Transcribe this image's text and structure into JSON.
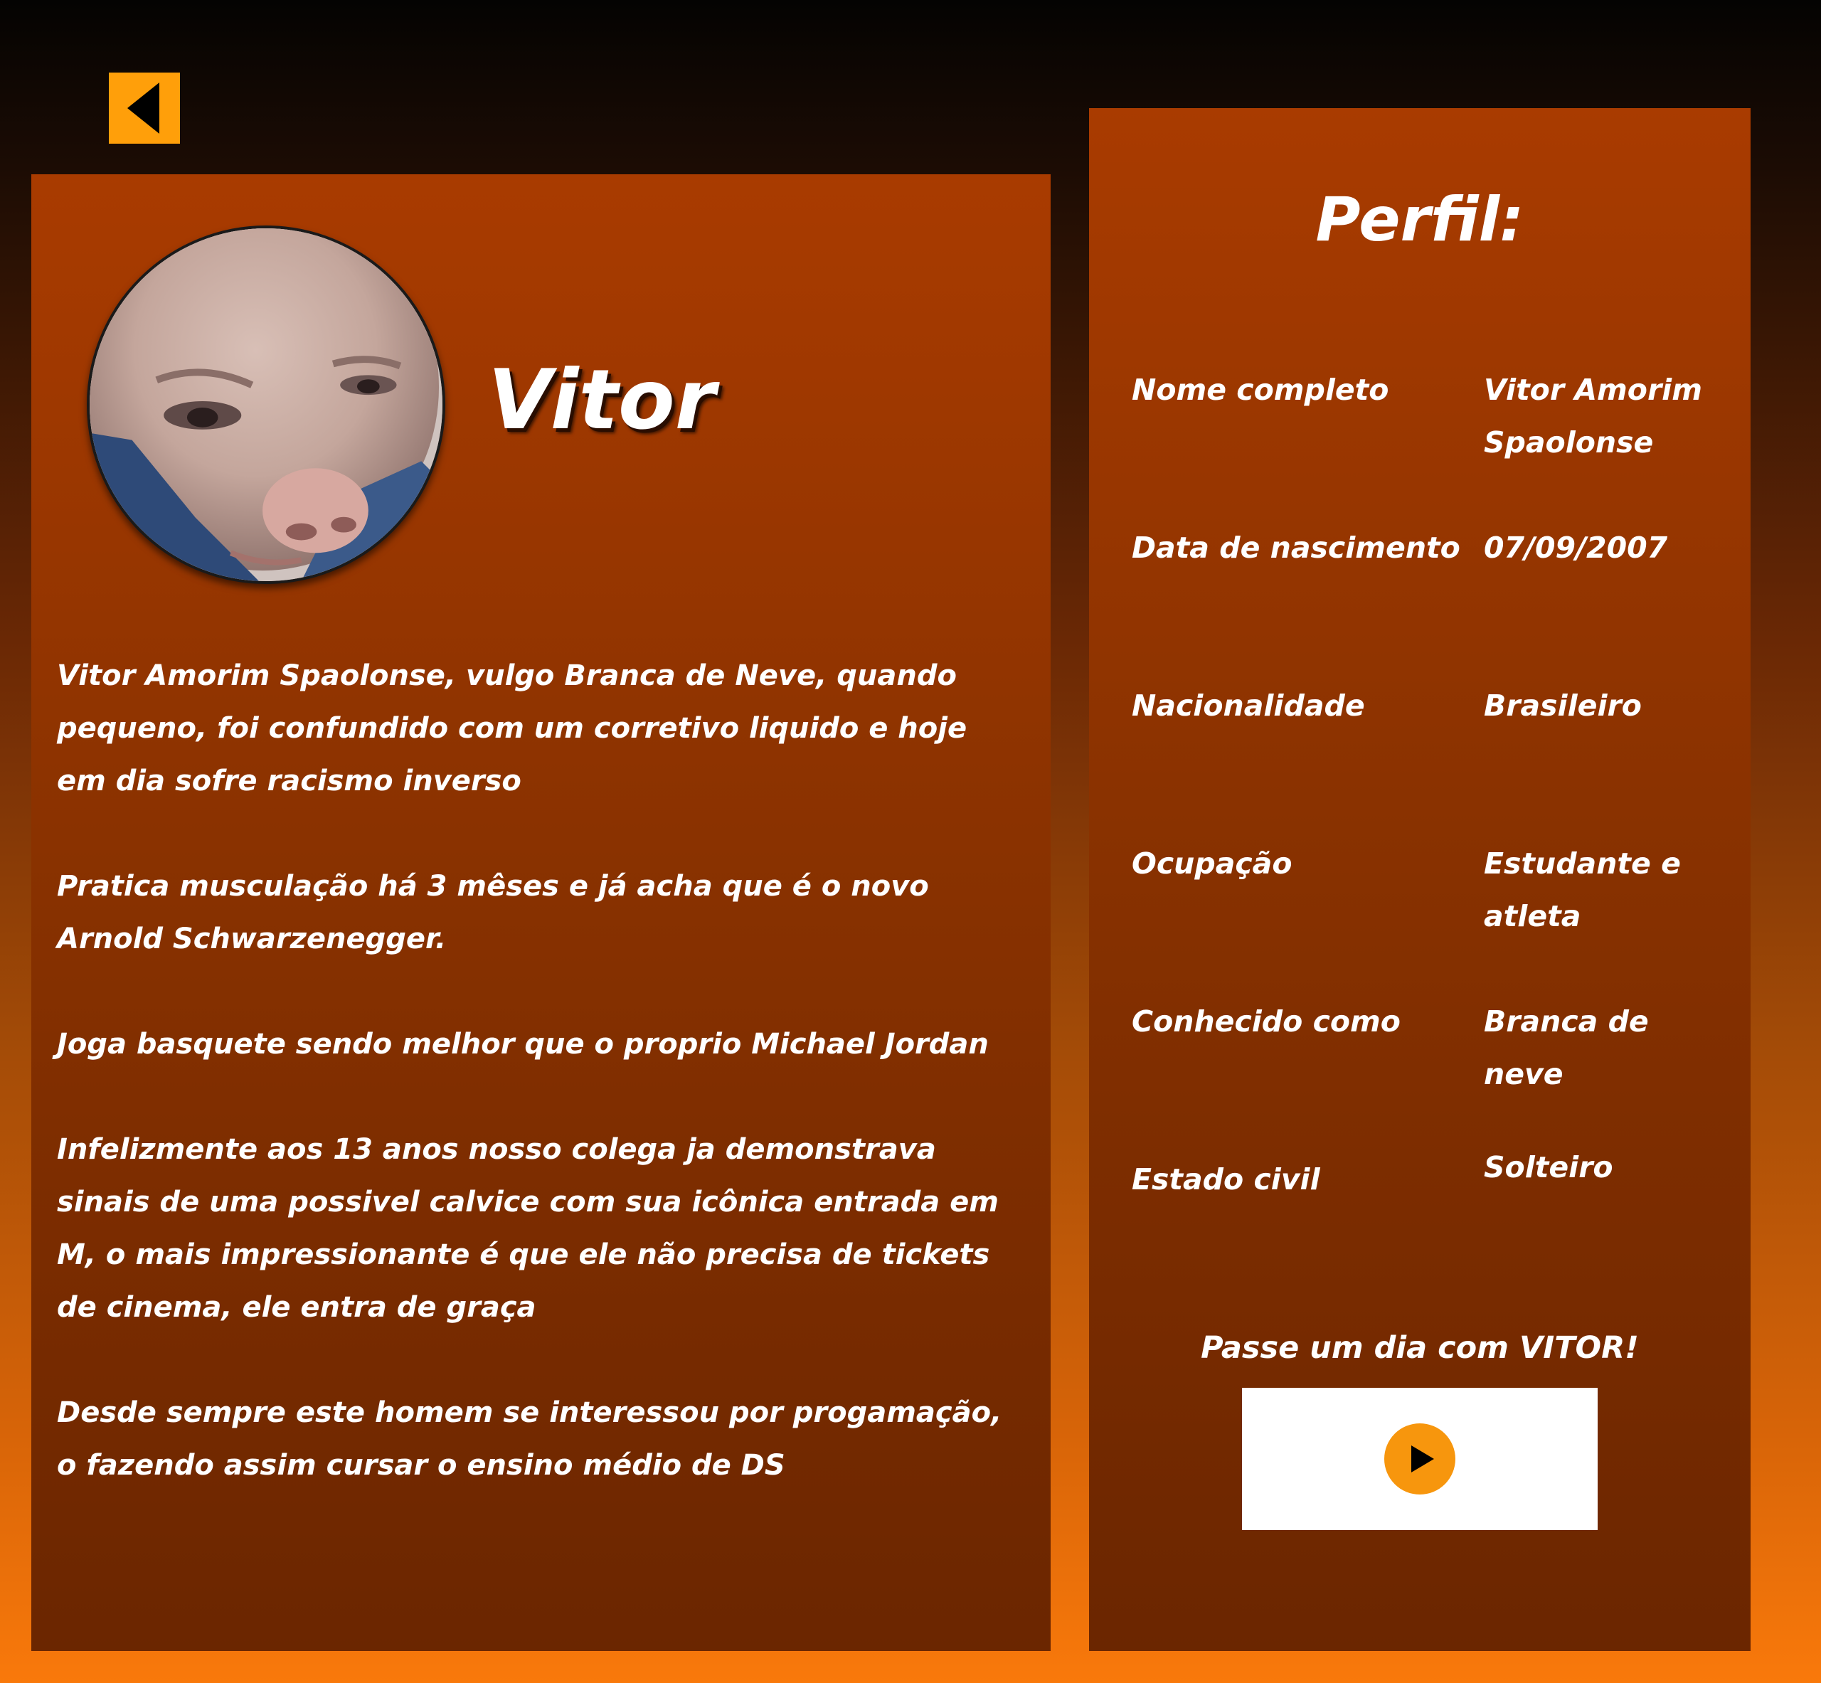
{
  "nav": {
    "back_icon": "triangle-left-icon"
  },
  "bio": {
    "avatar_alt": "Vitor",
    "name": "Vitor",
    "paragraphs": [
      "Vitor Amorim Spaolonse, vulgo Branca de Neve, quando pequeno, foi confundido com um corretivo liquido e hoje em dia sofre racismo inverso",
      "Pratica musculação há 3 mêses e já acha que é o novo Arnold Schwarzenegger.",
      "Joga basquete sendo melhor que o proprio Michael Jordan",
      "Infelizmente aos 13 anos nosso colega ja demonstrava sinais de uma possivel calvice com sua icônica entrada em M, o mais impressionante é que ele não precisa de tickets de cinema, ele entra de graça",
      "Desde sempre este homem se interessou por progamação, o fazendo assim cursar o ensino médio de DS"
    ]
  },
  "profile": {
    "title": "Perfil:",
    "rows": [
      {
        "label": "Nome completo",
        "value": "Vitor Amorim Spaolonse"
      },
      {
        "label": "Data de nascimento",
        "value": "07/09/2007"
      },
      {
        "label": "Nacionalidade",
        "value": "Brasileiro"
      },
      {
        "label": "Ocupação",
        "value": "Estudante e atleta"
      },
      {
        "label": "Conhecido como",
        "value": "Branca de neve"
      },
      {
        "label": "Estado civil",
        "value": "Solteiro"
      }
    ],
    "cta_text": "Passe um dia com VITOR!",
    "play_icon": "play-icon"
  },
  "colors": {
    "accent": "#ff9f0a",
    "panel": "#a93b00",
    "text": "#ffffff"
  }
}
